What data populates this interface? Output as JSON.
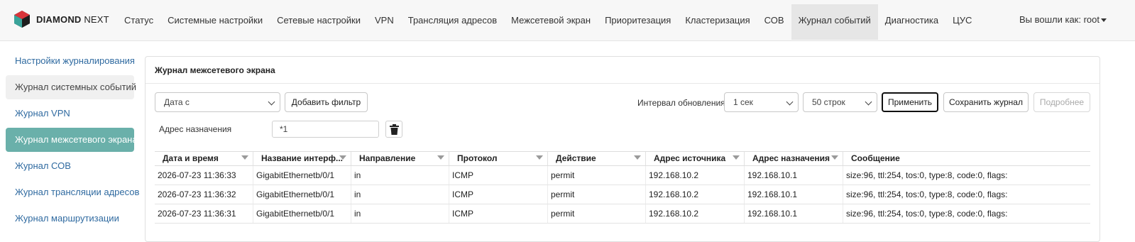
{
  "brand": {
    "name": "DIAMOND",
    "suffix": "NEXT"
  },
  "nav": {
    "items": [
      "Статус",
      "Системные настройки",
      "Сетевые настройки",
      "VPN",
      "Трансляция адресов",
      "Межсетевой экран",
      "Приоритезация",
      "Кластеризация",
      "СОВ",
      "Журнал событий",
      "Диагностика",
      "ЦУС"
    ],
    "active_index": 9,
    "user": "Вы вошли как: root"
  },
  "sidebar": {
    "items": [
      "Настройки журналирования",
      "Журнал системных событий",
      "Журнал VPN",
      "Журнал межсетевого экрана",
      "Журнал СОВ",
      "Журнал трансляции адресов",
      "Журнал маршрутизации"
    ],
    "active_index": 3
  },
  "panel": {
    "title": "Журнал межсетевого экрана",
    "date_select": "Дата с",
    "add_filter": "Добавить фильтр",
    "interval_label": "Интервал обновления",
    "interval_value": "1 сек",
    "rows_value": "50 строк",
    "apply": "Применить",
    "save": "Сохранить журнал",
    "details": "Подробнее",
    "filter_label": "Адрес назначения",
    "filter_value": "*1"
  },
  "table": {
    "columns": [
      "Дата и время",
      "Название интерф...",
      "Направление",
      "Протокол",
      "Действие",
      "Адрес источника",
      "Адрес назначения",
      "Сообщение"
    ],
    "rows": [
      [
        "2026-07-23 11:36:33",
        "GigabitEthernetb/0/1",
        "in",
        "ICMP",
        "permit",
        "192.168.10.2",
        "192.168.10.1",
        "size:96, ttl:254, tos:0, type:8, code:0, flags:"
      ],
      [
        "2026-07-23 11:36:32",
        "GigabitEthernetb/0/1",
        "in",
        "ICMP",
        "permit",
        "192.168.10.2",
        "192.168.10.1",
        "size:96, ttl:254, tos:0, type:8, code:0, flags:"
      ],
      [
        "2026-07-23 11:36:31",
        "GigabitEthernetb/0/1",
        "in",
        "ICMP",
        "permit",
        "192.168.10.2",
        "192.168.10.1",
        "size:96, ttl:254, tos:0, type:8, code:0, flags:"
      ]
    ]
  },
  "colors": {
    "accent": "#6ab0aa",
    "link": "#2f6aa0",
    "logo_red": "#d9343a",
    "logo_teal": "#3aa39a"
  },
  "icons": {
    "logo": "diamond-logo-icon",
    "trash": "trash-icon",
    "dropdown": "chevron-down-icon",
    "sort": "sort-icon",
    "user_caret": "caret-down-icon"
  }
}
